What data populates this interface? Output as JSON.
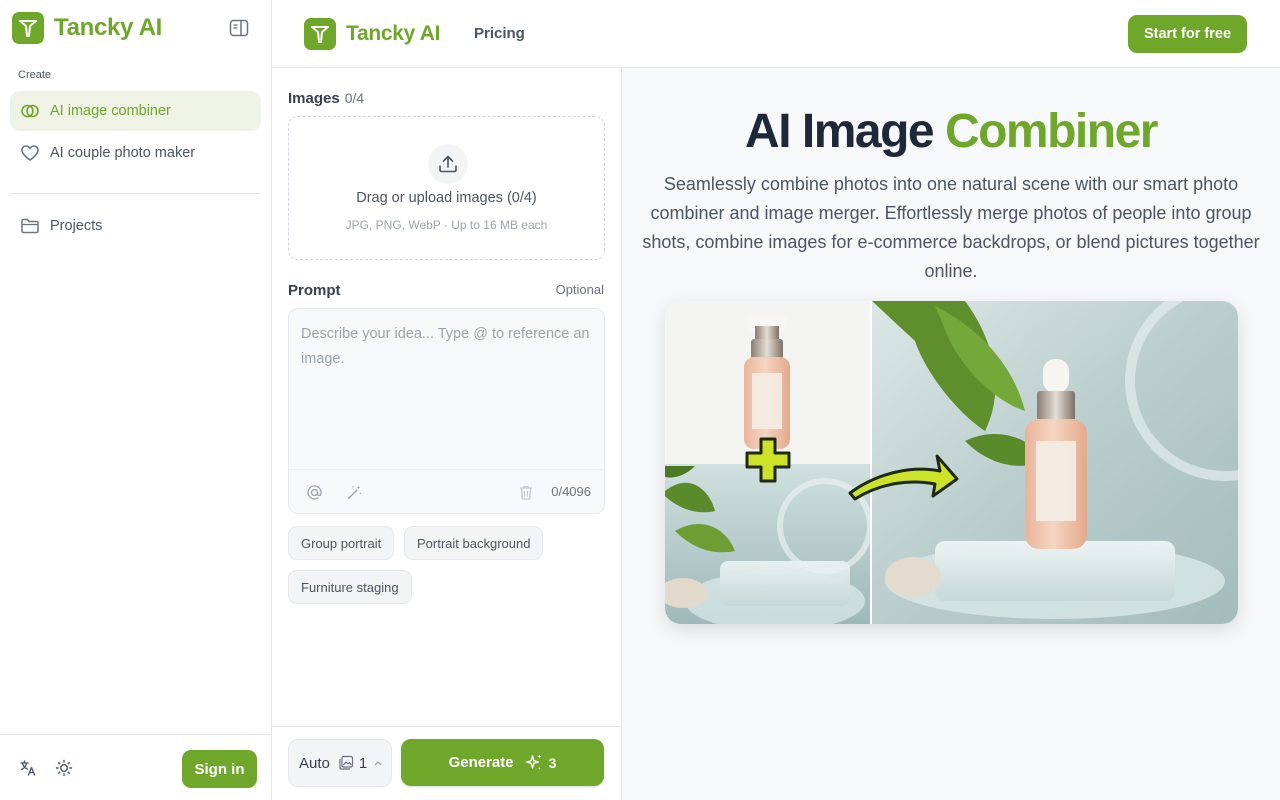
{
  "sidebar": {
    "brand": "Tancky AI",
    "section_label": "Create",
    "items": [
      {
        "label": "AI image combiner",
        "icon": "combine-icon",
        "active": true
      },
      {
        "label": "AI couple photo maker",
        "icon": "heart-icon",
        "active": false
      }
    ],
    "projects_label": "Projects",
    "signin_label": "Sign in"
  },
  "header": {
    "brand": "Tancky AI",
    "pricing_label": "Pricing",
    "cta_label": "Start for free"
  },
  "form": {
    "images_label": "Images",
    "images_count": "0/4",
    "drop_title": "Drag or upload images (0/4)",
    "drop_sub": "JPG, PNG, WebP · Up to 16 MB each",
    "prompt_label": "Prompt",
    "optional_label": "Optional",
    "prompt_placeholder": "Describe your idea... Type @ to reference an image.",
    "char_count": "0/4096",
    "chips": [
      "Group portrait",
      "Portrait background",
      "Furniture staging"
    ],
    "ratio_label": "Auto",
    "count_value": "1",
    "generate_label": "Generate",
    "generate_cost": "3"
  },
  "hero": {
    "title_main": "AI Image",
    "title_accent": "Combiner",
    "description": "Seamlessly combine photos into one natural scene with our smart photo combiner and image merger. Effortlessly merge photos of people into group shots, combine images for e-commerce backdrops, or blend pictures together online."
  },
  "colors": {
    "accent": "#6fa72a",
    "title": "#1e2838"
  }
}
